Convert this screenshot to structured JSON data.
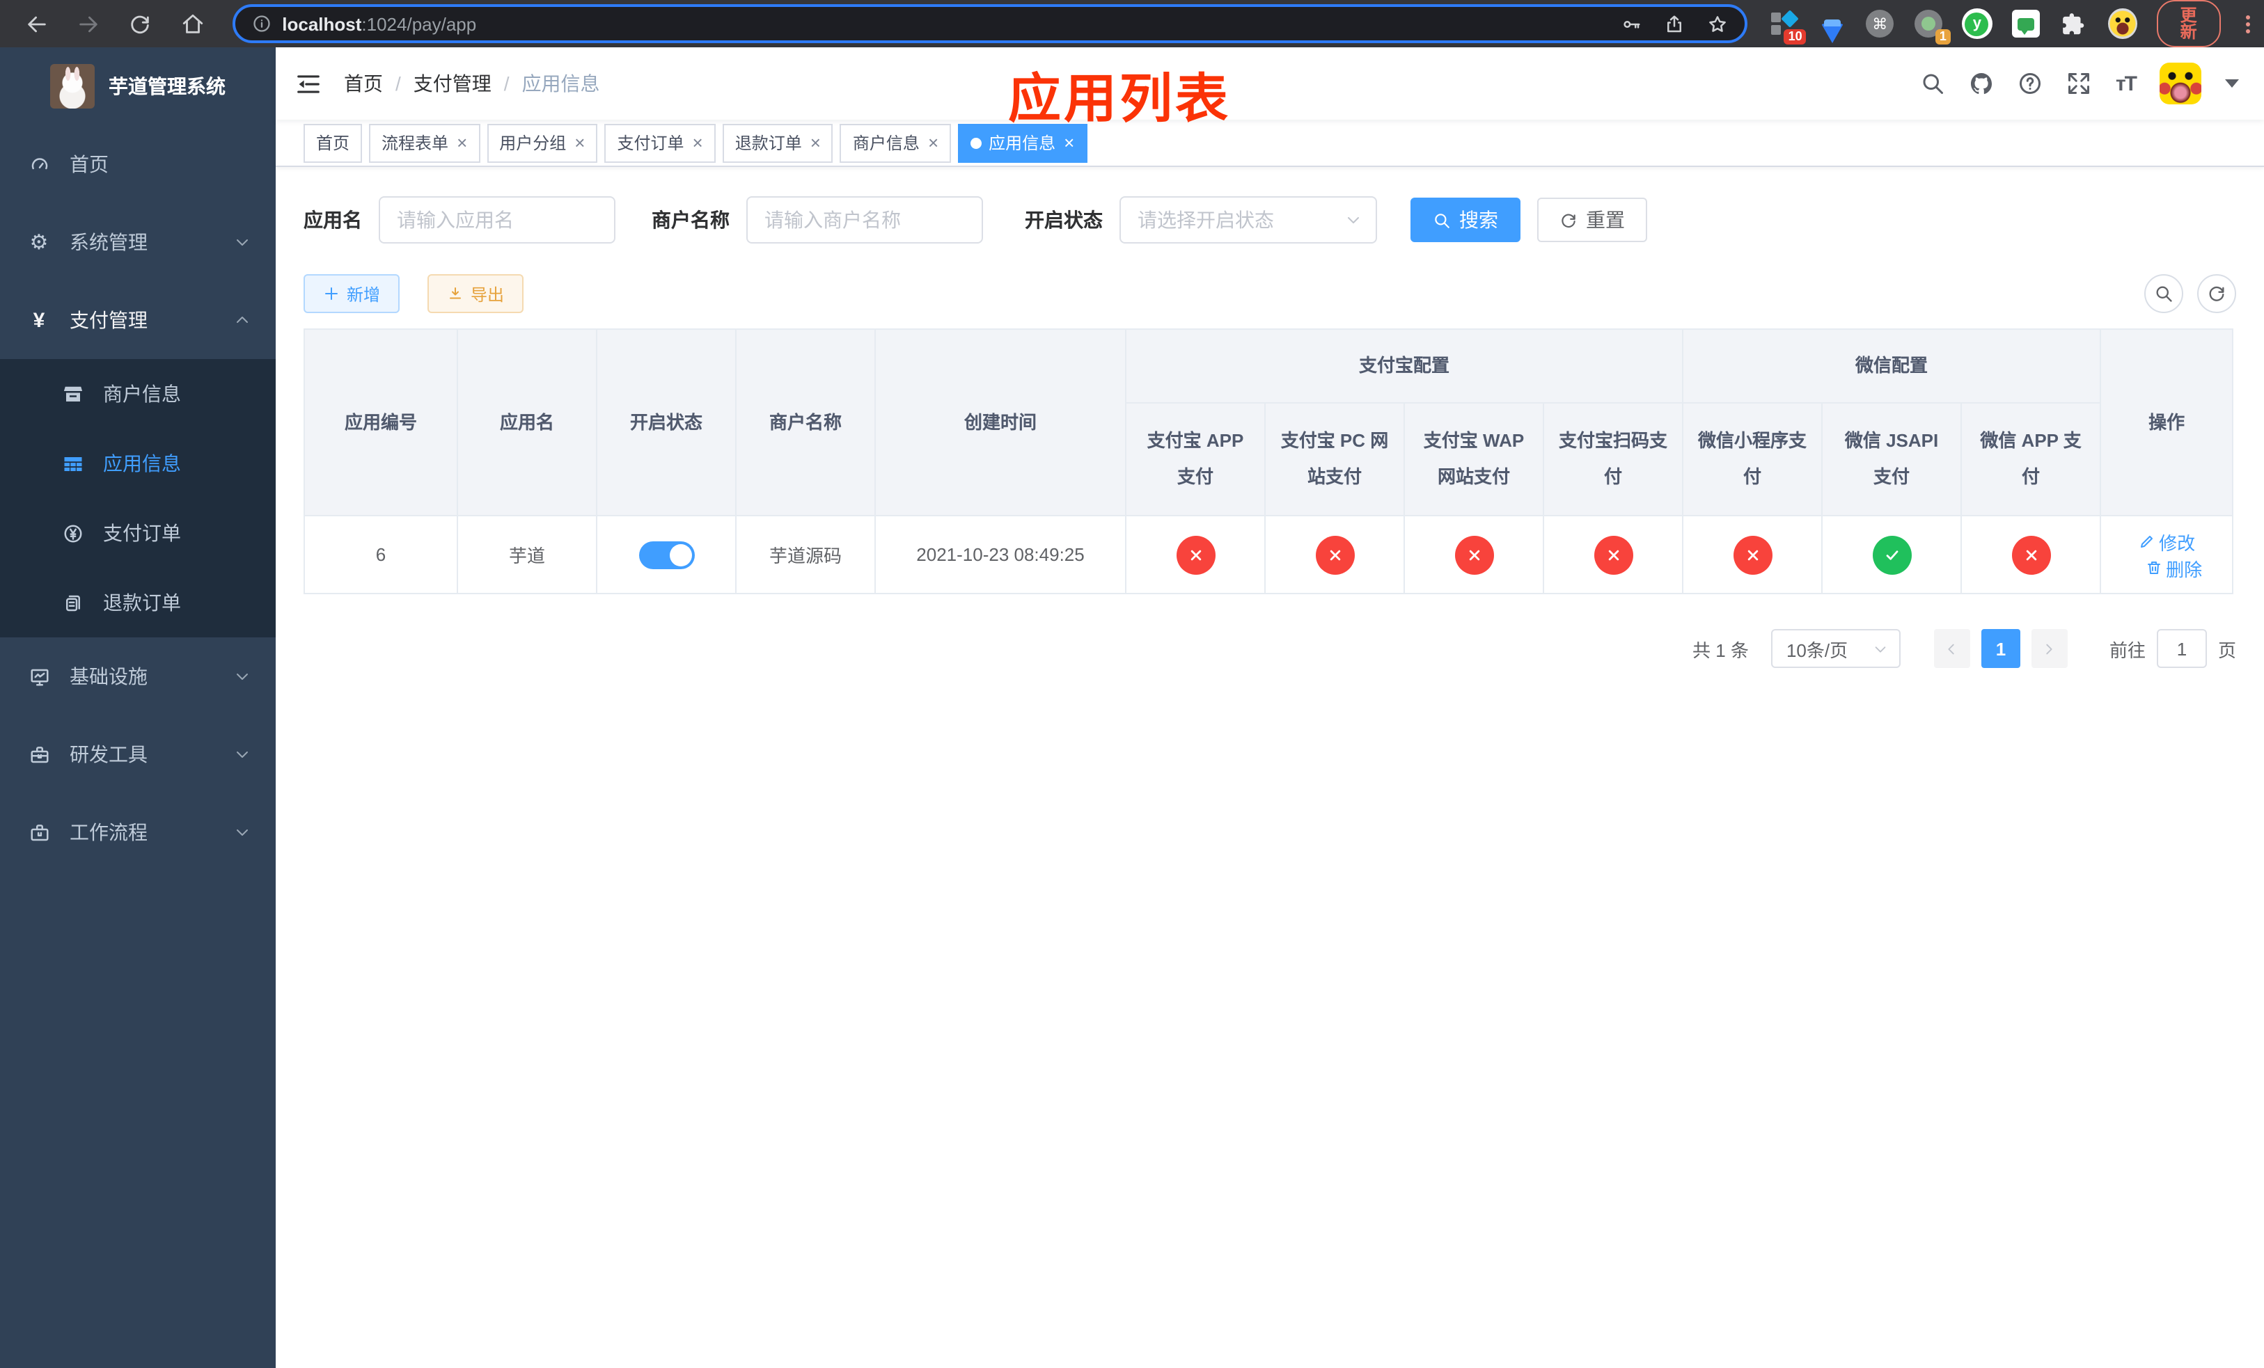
{
  "browser": {
    "url_host": "localhost",
    "url_rest": ":1024/pay/app",
    "update_label": "更新",
    "ext_badges": {
      "grid": "10",
      "screen": "1"
    },
    "ext_y_letter": "y",
    "cmd_glyph": "⌘"
  },
  "annotation": {
    "text": "应用列表",
    "color": "#fb3307"
  },
  "sidebar": {
    "logo_title": "芋道管理系统",
    "menu": [
      {
        "label": "首页",
        "icon": "dashboard-icon"
      },
      {
        "label": "系统管理",
        "icon": "gear-icon"
      },
      {
        "label": "支付管理",
        "icon": "yen-icon",
        "open": true
      },
      {
        "label": "商户信息",
        "icon": "shop-icon",
        "sub": true
      },
      {
        "label": "应用信息",
        "icon": "grid-icon",
        "sub": true,
        "active": true
      },
      {
        "label": "支付订单",
        "icon": "yen-circle-icon",
        "sub": true
      },
      {
        "label": "退款订单",
        "icon": "document-icon",
        "sub": true
      },
      {
        "label": "基础设施",
        "icon": "monitor-icon"
      },
      {
        "label": "研发工具",
        "icon": "toolbox-icon"
      },
      {
        "label": "工作流程",
        "icon": "briefcase-icon"
      }
    ],
    "yen_glyph": "¥",
    "gear_glyph": "⚙"
  },
  "navbar": {
    "breadcrumb": [
      "首页",
      "支付管理",
      "应用信息"
    ]
  },
  "tabs": [
    {
      "label": "首页",
      "closable": false,
      "active": false
    },
    {
      "label": "流程表单",
      "closable": true,
      "active": false
    },
    {
      "label": "用户分组",
      "closable": true,
      "active": false
    },
    {
      "label": "支付订单",
      "closable": true,
      "active": false
    },
    {
      "label": "退款订单",
      "closable": true,
      "active": false
    },
    {
      "label": "商户信息",
      "closable": true,
      "active": false
    },
    {
      "label": "应用信息",
      "closable": true,
      "active": true
    }
  ],
  "filters": {
    "app_name_label": "应用名",
    "app_name_placeholder": "请输入应用名",
    "merchant_label": "商户名称",
    "merchant_placeholder": "请输入商户名称",
    "status_label": "开启状态",
    "status_placeholder": "请选择开启状态",
    "search_label": "搜索",
    "reset_label": "重置"
  },
  "toolbar": {
    "add_label": "新增",
    "export_label": "导出"
  },
  "table": {
    "group_alipay": "支付宝配置",
    "group_wechat": "微信配置",
    "columns": [
      "应用编号",
      "应用名",
      "开启状态",
      "商户名称",
      "创建时间",
      "支付宝 APP 支付",
      "支付宝 PC 网站支付",
      "支付宝 WAP 网站支付",
      "支付宝扫码支付",
      "微信小程序支付",
      "微信 JSAPI 支付",
      "微信 APP 支付",
      "操作"
    ],
    "row": {
      "id": "6",
      "name": "芋道",
      "enabled": true,
      "merchant": "芋道源码",
      "created_at": "2021-10-23 08:49:25",
      "statuses": [
        "no",
        "no",
        "no",
        "no",
        "no",
        "yes",
        "no"
      ],
      "edit_label": "修改",
      "delete_label": "删除"
    }
  },
  "pagination": {
    "total": "共 1 条",
    "page_size": "10条/页",
    "page": "1",
    "goto_label": "前往",
    "goto_value": "1",
    "unit_label": "页"
  },
  "colors": {
    "accent": "#409eff",
    "danger": "#f8433c",
    "success": "#20c05c",
    "sidebar_bg": "#304156",
    "submenu_bg": "#1f2d3d"
  }
}
